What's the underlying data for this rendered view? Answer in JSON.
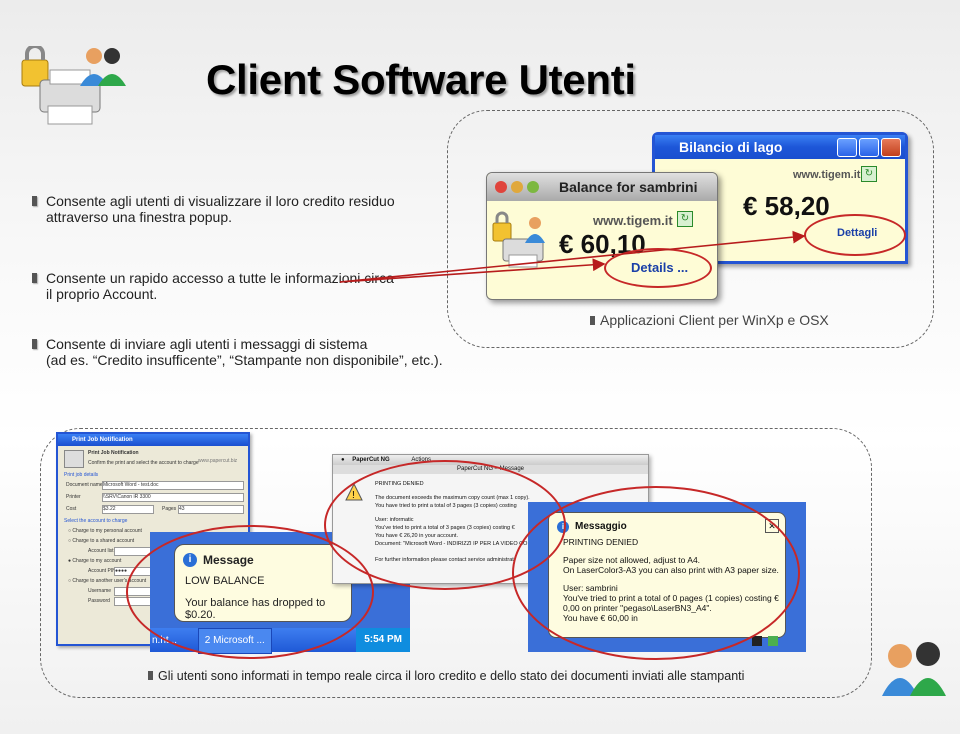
{
  "title": "Client Software Utenti",
  "bullets": [
    {
      "line1": "Consente agli utenti di visualizzare il loro credito residuo",
      "line2": "attraverso una finestra popup."
    },
    {
      "line1": "Consente un rapido accesso a tutte le informazioni circa",
      "line2": "il proprio Account."
    },
    {
      "line1": "Consente  di inviare agli utenti i messaggi di sistema",
      "line2": "(ad es. “Credito insufficente”, “Stampante non disponibile”, etc.)."
    }
  ],
  "caption_top": "Applicazioni Client per WinXp e OSX",
  "caption_bottom": "Gli utenti sono informati in tempo reale circa il loro credito e dello stato dei documenti inviati alle stampanti",
  "xp_balance": {
    "title": "Bilancio di lago",
    "url": "www.tigem.it",
    "amount": "€ 58,20",
    "link": "Dettagli"
  },
  "mac_balance": {
    "title": "Balance for sambrini",
    "url": "www.tigem.it",
    "amount": "€ 60,10",
    "link": "Details ..."
  },
  "print_job": {
    "title": "Print Job Notification",
    "header": "Print Job Notification",
    "subtitle": "Confirm the print and select the account to charge",
    "section1": "Print job details",
    "fields": [
      {
        "label": "Document name",
        "value": "Microsoft Word - test.doc"
      },
      {
        "label": "Printer",
        "value": "\\\\SRV\\Canon iR 3300"
      },
      {
        "label": "Cost",
        "value": "$3.22"
      },
      {
        "label": "Pages",
        "value": "43"
      }
    ],
    "section2": "Select the account to charge",
    "options": [
      "Charge to my personal account",
      "Charge to a shared account",
      "Charge to my account",
      "Charge to another user's account"
    ],
    "account_list": "Account list",
    "account_pin_label": "Account PIN",
    "account_pin": "●●●●",
    "username_label": "Username",
    "password_label": "Password",
    "footer": "www.papercut.biz"
  },
  "low_balance": {
    "title": "Message",
    "heading": "LOW BALANCE",
    "text": "Your balance has dropped to $0.20.",
    "taskbar_left": "n.ht...",
    "taskbar_mid": "2 Microsoft ...",
    "clock": "5:54 PM"
  },
  "papercut_msg": {
    "menu_app": "PaperCut NG",
    "menu_actions": "Actions",
    "title": "PaperCut NG – Message",
    "heading": "PRINTING DENIED",
    "lines": [
      "The document exceeds the maximum copy count (max 1 copy).",
      "You have tried to print a total of 3 pages (3 copies) costing",
      "User: informatic",
      "You've tried to print a total of 3 pages (3 copies) costing €",
      "You have € 26,20 in your account.",
      "Document: \"Microsoft Word - INDIRIZZI IP PER LA VIDEO CO",
      "For further information please contact service administrat"
    ]
  },
  "xp_msg": {
    "title": "Messaggio",
    "heading": "PRINTING DENIED",
    "lines": [
      "Paper size not allowed, adjust to A4.",
      "On LaserColor3-A3 you can also print with A3 paper size.",
      "User: sambrini",
      "You've tried to print a total of 0 pages (1 copies) costing €",
      "0,00 on printer \"pegaso\\LaserBN3_A4\".",
      "You have € 60,00 in"
    ]
  },
  "colors": {
    "xp_blue": "#2455d4",
    "balloon": "#fefcd6",
    "highlight": "#c62828"
  }
}
